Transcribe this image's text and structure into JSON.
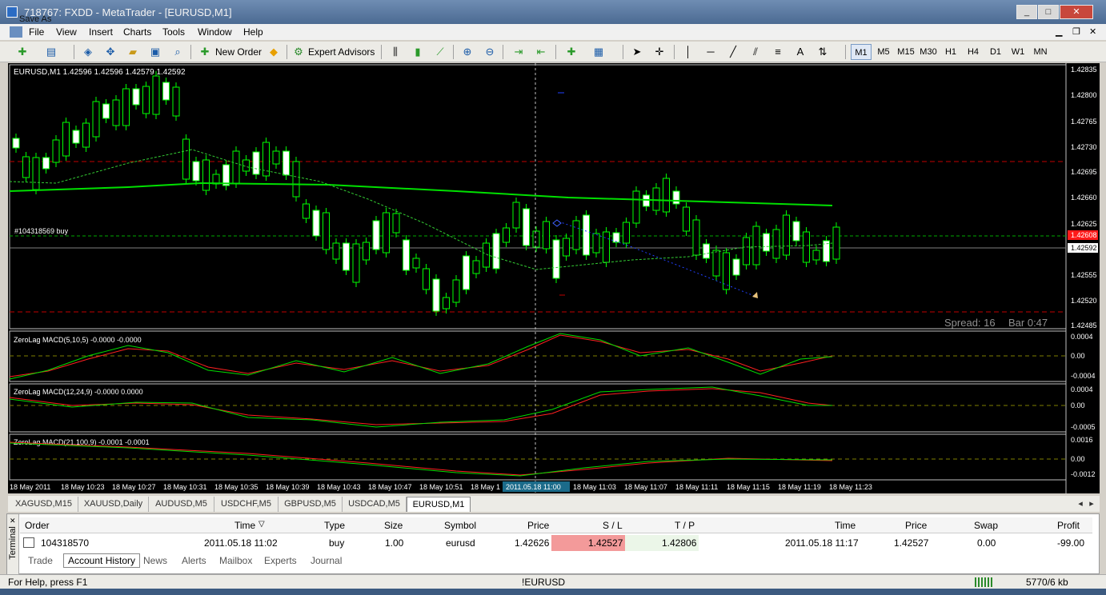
{
  "window": {
    "title": "718767: FXDD - MetaTrader - [EURUSD,M1]",
    "overlay": "Save As"
  },
  "menu": [
    "File",
    "View",
    "Insert",
    "Charts",
    "Tools",
    "Window",
    "Help"
  ],
  "toolbar": {
    "new_order": "New Order",
    "expert_advisors": "Expert Advisors",
    "drawing_text": "A",
    "timeframes": [
      "M1",
      "M5",
      "M15",
      "M30",
      "H1",
      "H4",
      "D1",
      "W1",
      "MN"
    ],
    "active_timeframe": "M1"
  },
  "chart": {
    "info": "EURUSD,M1  1.42596 1.42596 1.42579 1.42592",
    "order_label": "#104318569 buy",
    "price_axis": [
      "1.42835",
      "1.42800",
      "1.42765",
      "1.42730",
      "1.42695",
      "1.42660",
      "1.42625",
      "1.42592",
      "1.42555",
      "1.42520",
      "1.42485"
    ],
    "sl_tag": "1.42608",
    "current_tag": "1.42592",
    "spread": "Spread: 16",
    "bar_timer": "Bar  0:47",
    "time_axis": [
      "18 May 2011",
      "18 May 10:23",
      "18 May 10:27",
      "18 May 10:31",
      "18 May 10:35",
      "18 May 10:39",
      "18 May 10:43",
      "18 May 10:47",
      "18 May 10:51",
      "18 May 1",
      "18 May 11:03",
      "18 May 11:07",
      "18 May 11:11",
      "18 May 11:15",
      "18 May 11:19",
      "18 May 11:23"
    ],
    "crosshair_time": "2011.05.18 11:00",
    "macd1": {
      "label": "ZeroLag MACD(5,10,5) -0.0000 -0.0000",
      "axis": [
        "0.0004",
        "0.00",
        "-0.0004"
      ]
    },
    "macd2": {
      "label": "ZeroLag MACD(12,24,9) -0.0000 0.0000",
      "axis": [
        "0.0004",
        "0.00",
        "-0.0005"
      ]
    },
    "macd3": {
      "label": "ZeroLag MACD(21,100,9) -0.0001 -0.0001",
      "axis": [
        "0.0016",
        "0.00",
        "-0.0012"
      ]
    },
    "colors": {
      "bull": "#ffffff",
      "ma_fast": "#00ff00",
      "macd_main": "#00dd00",
      "macd_signal": "#ff2020",
      "level": "#c00000"
    }
  },
  "symbol_tabs": [
    "XAGUSD,M15",
    "XAUUSD,Daily",
    "AUDUSD,M5",
    "USDCHF,M5",
    "GBPUSD,M5",
    "USDCAD,M5",
    "EURUSD,M1"
  ],
  "terminal": {
    "side_label": "Terminal",
    "headers": {
      "order": "Order",
      "time": "Time",
      "type": "Type",
      "size": "Size",
      "symbol": "Symbol",
      "price": "Price",
      "sl": "S / L",
      "tp": "T / P",
      "close_time": "Time",
      "close_price": "Price",
      "swap": "Swap",
      "profit": "Profit"
    },
    "row": {
      "order": "104318570",
      "time": "2011.05.18 11:02",
      "type": "buy",
      "size": "1.00",
      "symbol": "eurusd",
      "price": "1.42626",
      "sl": "1.42527",
      "tp": "1.42806",
      "close_time": "2011.05.18 11:17",
      "close_price": "1.42527",
      "swap": "0.00",
      "profit": "-99.00"
    },
    "tabs": [
      "Trade",
      "Account History",
      "News",
      "Alerts",
      "Mailbox",
      "Experts",
      "Journal"
    ],
    "active_tab": "Account History"
  },
  "status": {
    "help": "For Help, press F1",
    "profile": "!EURUSD",
    "traffic": "5770/6 kb"
  }
}
